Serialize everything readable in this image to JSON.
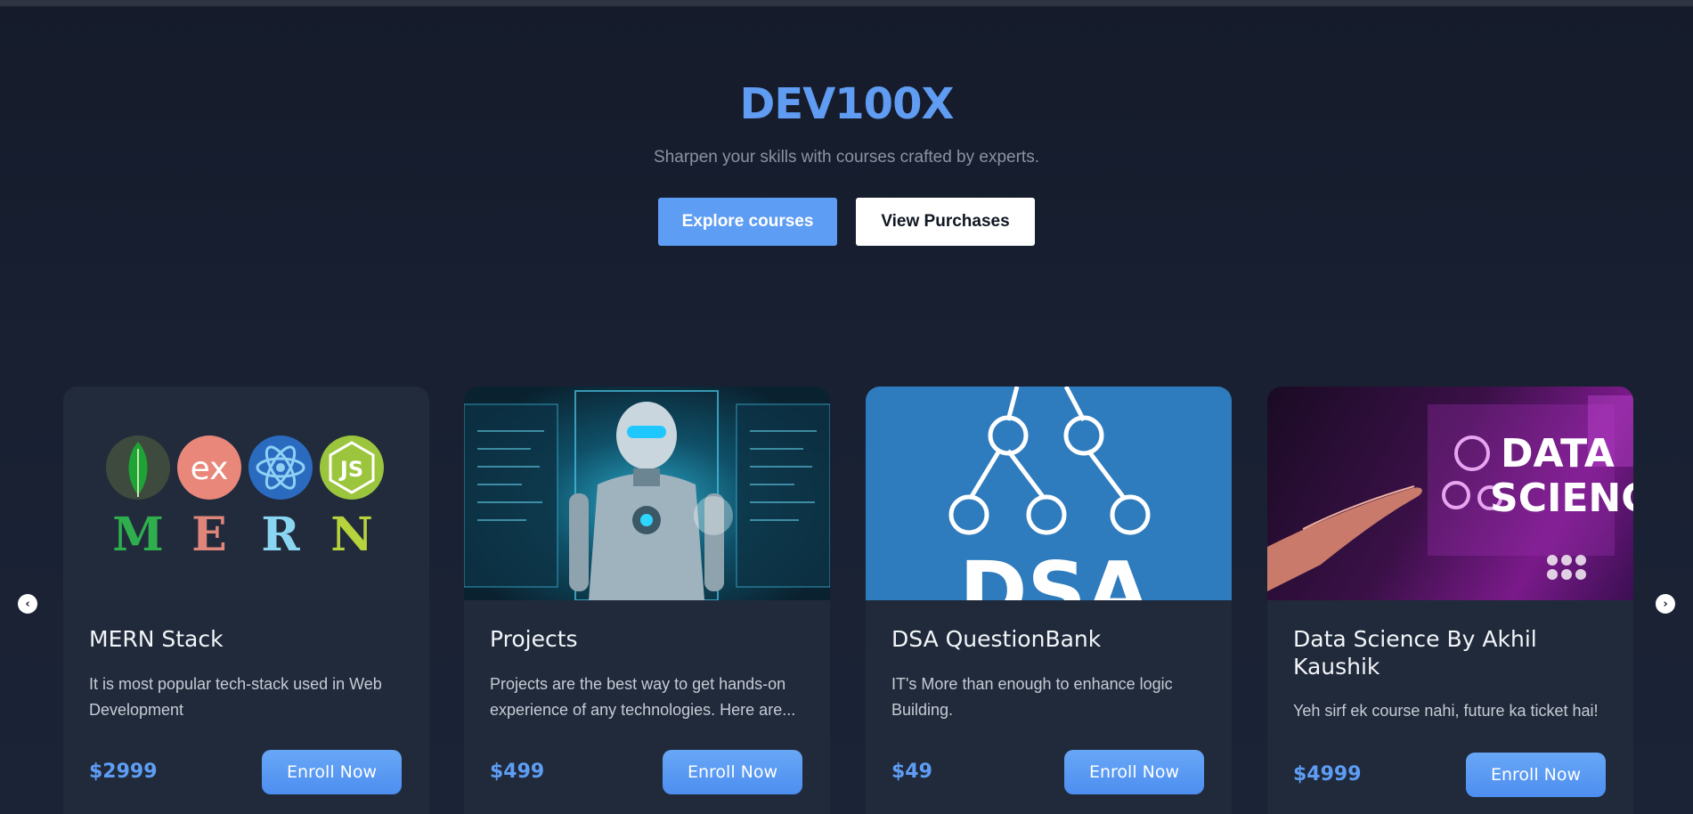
{
  "hero": {
    "title": "DEV100X",
    "subtitle": "Sharpen your skills with courses crafted by experts.",
    "explore_label": "Explore courses",
    "purchases_label": "View Purchases"
  },
  "carousel": {
    "prev_icon": "chevron-left-icon",
    "next_icon": "chevron-right-icon",
    "prev_glyph": "‹",
    "next_glyph": "›"
  },
  "courses": [
    {
      "title": "MERN Stack",
      "description": "It is most popular tech-stack used in Web Development",
      "price": "$2999",
      "enroll_label": "Enroll Now",
      "image": {
        "logo_labels": [
          "ex",
          "JS"
        ],
        "letters": [
          "M",
          "E",
          "R",
          "N"
        ]
      }
    },
    {
      "title": "Projects",
      "description": "Projects are the best way to get hands-on experience of any technologies. Here are...",
      "price": "$499",
      "enroll_label": "Enroll Now"
    },
    {
      "title": "DSA QuestionBank",
      "description": "IT's More than enough to enhance logic Building.",
      "price": "$49",
      "enroll_label": "Enroll Now",
      "image": {
        "text": "DSA"
      }
    },
    {
      "title": "Data Science By Akhil Kaushik",
      "description": "Yeh sirf ek course nahi, future ka ticket hai!",
      "price": "$4999",
      "enroll_label": "Enroll Now",
      "image": {
        "text_line1": "DATA",
        "text_line2": "SCIENCE"
      }
    }
  ],
  "colors": {
    "accent": "#5e9df4",
    "background": "#182032",
    "card": "#202a3b"
  }
}
